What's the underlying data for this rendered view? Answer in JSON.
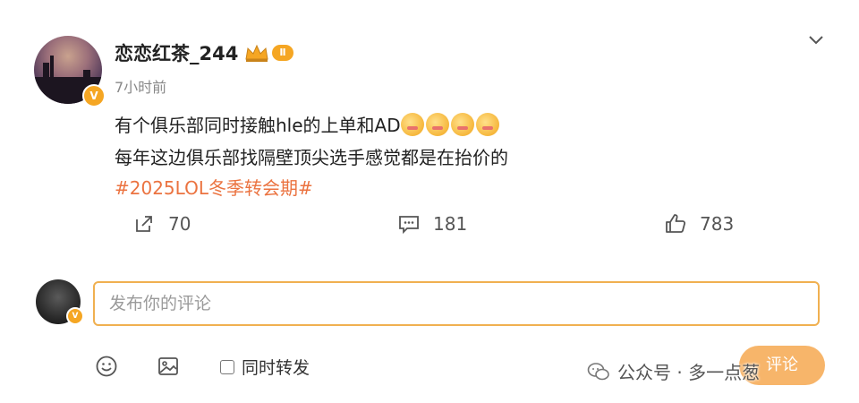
{
  "post": {
    "username": "恋恋红茶_244",
    "level_badge": "Ⅱ",
    "verified_badge": "V",
    "time": "7小时前",
    "lines": [
      "有个俱乐部同时接触hle的上单和AD",
      "每年这边俱乐部找隔壁顶尖选手感觉都是在抬价的"
    ],
    "emoji_count": 4,
    "hashtag": "#2025LOL冬季转会期#"
  },
  "actions": {
    "repost": "70",
    "comment": "181",
    "like": "783"
  },
  "composer": {
    "placeholder": "发布你的评论",
    "verified_badge": "V",
    "repost_label": "同时转发",
    "submit_label": "评论"
  },
  "watermark": {
    "text": "公众号 · 多一点葱"
  },
  "colors": {
    "accent": "#f5a623",
    "hashtag": "#eb7340",
    "input_border": "#f0b050"
  }
}
